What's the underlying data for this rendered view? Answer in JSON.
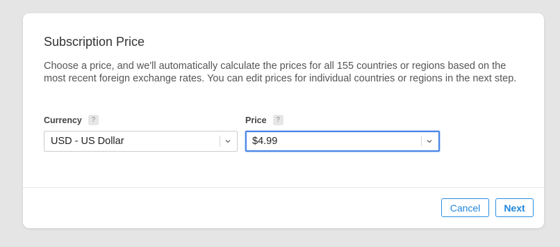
{
  "dialog": {
    "title": "Subscription Price",
    "description": "Choose a price, and we'll automatically calculate the prices for all 155 countries or regions based on the most recent foreign exchange rates. You can edit prices for individual countries or regions in the next step."
  },
  "currency": {
    "label": "Currency",
    "help": "?",
    "selected": "USD - US Dollar"
  },
  "price": {
    "label": "Price",
    "help": "?",
    "selected": "$4.99"
  },
  "footer": {
    "cancel_label": "Cancel",
    "next_label": "Next"
  },
  "colors": {
    "accent": "#1f86dd",
    "focus": "#4a86e8"
  }
}
